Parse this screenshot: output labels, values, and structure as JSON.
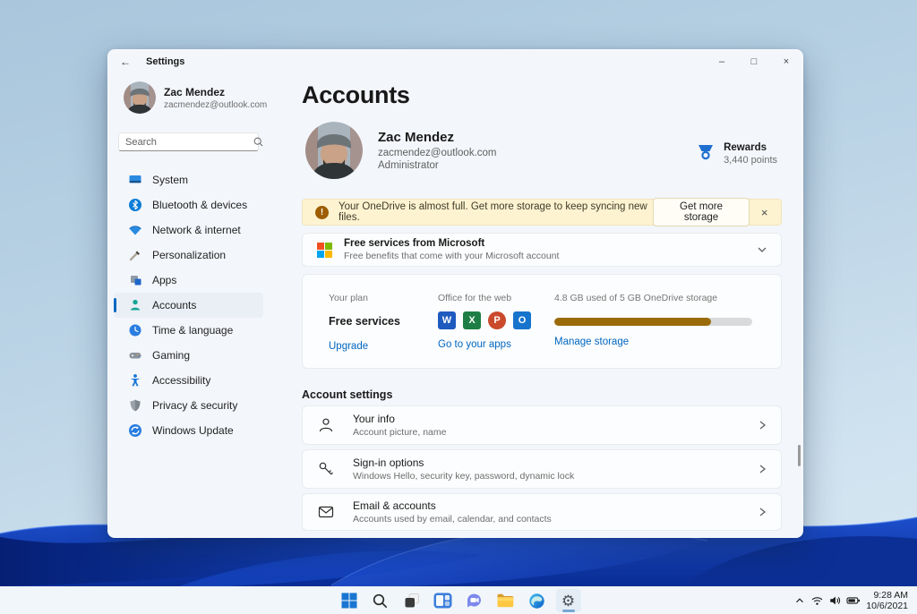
{
  "window": {
    "title": "Settings"
  },
  "sidebar": {
    "user": {
      "name": "Zac Mendez",
      "email": "zacmendez@outlook.com"
    },
    "search": {
      "placeholder": "Search"
    },
    "items": [
      {
        "label": "System"
      },
      {
        "label": "Bluetooth & devices"
      },
      {
        "label": "Network & internet"
      },
      {
        "label": "Personalization"
      },
      {
        "label": "Apps"
      },
      {
        "label": "Accounts"
      },
      {
        "label": "Time & language"
      },
      {
        "label": "Gaming"
      },
      {
        "label": "Accessibility"
      },
      {
        "label": "Privacy & security"
      },
      {
        "label": "Windows Update"
      }
    ]
  },
  "main": {
    "page_title": "Accounts",
    "profile": {
      "name": "Zac Mendez",
      "email": "zacmendez@outlook.com",
      "role": "Administrator"
    },
    "rewards": {
      "label": "Rewards",
      "points": "3,440 points"
    },
    "banner": {
      "message": "Your OneDrive is almost full. Get more storage to keep syncing new files.",
      "button_label": "Get more storage"
    },
    "free_card": {
      "title": "Free services from Microsoft",
      "subtitle": "Free benefits that come with your Microsoft account"
    },
    "plan": {
      "col1": {
        "header": "Your plan",
        "value": "Free services",
        "link": "Upgrade"
      },
      "col2": {
        "header": "Office for the web",
        "apps": [
          {
            "name": "Word",
            "letter": "W"
          },
          {
            "name": "Excel",
            "letter": "X"
          },
          {
            "name": "PowerPoint",
            "letter": "P"
          },
          {
            "name": "Outlook",
            "letter": "O"
          }
        ],
        "link": "Go to your apps"
      },
      "col3": {
        "header": "4.8 GB used of 5 GB OneDrive storage",
        "progress_percent": 79,
        "link": "Manage storage"
      }
    },
    "settings_section": {
      "heading": "Account settings",
      "rows": [
        {
          "title": "Your info",
          "subtitle": "Account picture, name"
        },
        {
          "title": "Sign-in options",
          "subtitle": "Windows Hello, security key, password, dynamic lock"
        },
        {
          "title": "Email & accounts",
          "subtitle": "Accounts used by email, calendar, and contacts"
        }
      ]
    }
  },
  "taskbar": {
    "apps": [
      "start",
      "search",
      "task-view",
      "widgets",
      "chat",
      "file-explorer",
      "edge",
      "settings"
    ],
    "tray": {
      "time": "9:28 AM",
      "date": "10/6/2021"
    }
  },
  "colors": {
    "accent": "#0067C0",
    "link": "#0066C0",
    "banner_bg": "#FDF3D1",
    "warning": "#9D5D00",
    "progress_fill": "#9A6B0A"
  }
}
